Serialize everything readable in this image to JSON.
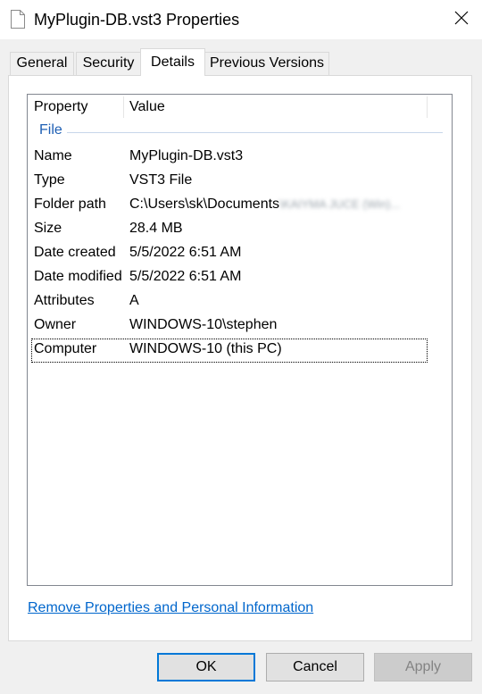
{
  "window": {
    "title": "MyPlugin-DB.vst3 Properties",
    "icons": {
      "file": "document-icon",
      "close": "close-icon"
    }
  },
  "tabs": [
    {
      "label": "General",
      "active": false
    },
    {
      "label": "Security",
      "active": false
    },
    {
      "label": "Details",
      "active": true
    },
    {
      "label": "Previous Versions",
      "active": false
    }
  ],
  "details": {
    "columns": {
      "property": "Property",
      "value": "Value"
    },
    "group": "File",
    "rows": [
      {
        "property": "Name",
        "value": "MyPlugin-DB.vst3"
      },
      {
        "property": "Type",
        "value": "VST3 File"
      },
      {
        "property": "Folder path",
        "value": "C:\\Users\\sk\\Documents",
        "value_blurred": "\\KAIYMA JUCE (Win)..."
      },
      {
        "property": "Size",
        "value": "28.4 MB"
      },
      {
        "property": "Date created",
        "value": "5/5/2022 6:51 AM"
      },
      {
        "property": "Date modified",
        "value": "5/5/2022 6:51 AM"
      },
      {
        "property": "Attributes",
        "value": "A"
      },
      {
        "property": "Owner",
        "value": "WINDOWS-10\\stephen"
      },
      {
        "property": "Computer",
        "value": "WINDOWS-10 (this PC)",
        "focused": true
      }
    ]
  },
  "link": {
    "label": "Remove Properties and Personal Information"
  },
  "buttons": {
    "ok": "OK",
    "cancel": "Cancel",
    "apply": "Apply",
    "apply_disabled": true
  },
  "colors": {
    "accent": "#0078d7",
    "link": "#0066cc",
    "group_header": "#1e5fb4"
  }
}
